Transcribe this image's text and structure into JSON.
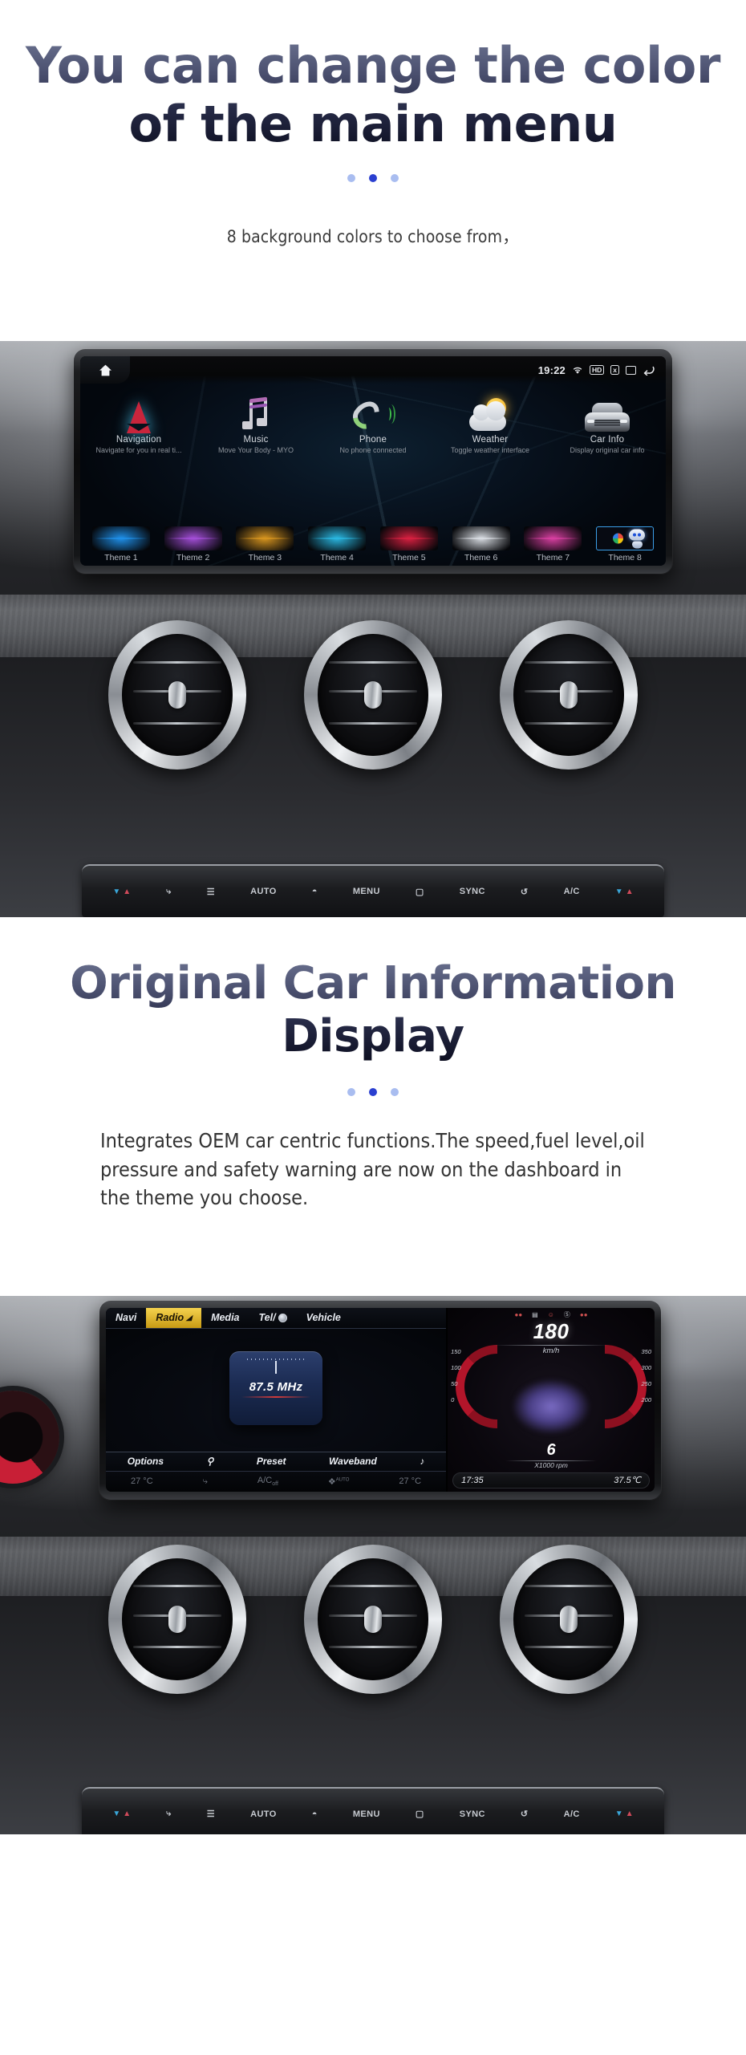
{
  "section1": {
    "title_line1": "You can change the color",
    "title_line2": "of the main menu",
    "subtitle": "8 background colors  to choose from，"
  },
  "section2": {
    "title_line1": "Original Car Information",
    "title_line2": "Display",
    "body": "Integrates OEM car centric functions.The speed,fuel level,oil pressure and safety warning are now on the dashboard in the theme you choose."
  },
  "headunit1": {
    "statusbar": {
      "home_icon": "home-icon",
      "time": "19:22",
      "wifi_icon": "wifi-icon",
      "hd_label": "HD",
      "sd_label": "x",
      "recent_icon": "recent-apps-icon",
      "back_icon": "back-arrow-icon"
    },
    "apps": [
      {
        "name": "Navigation",
        "desc": "Navigate for you in real ti...",
        "icon": "navigation-arrow-icon"
      },
      {
        "name": "Music",
        "desc": "Move Your Body - MYO",
        "icon": "music-note-icon"
      },
      {
        "name": "Phone",
        "desc": "No phone connected",
        "icon": "phone-handset-icon"
      },
      {
        "name": "Weather",
        "desc": "Toggle weather interface",
        "icon": "sun-cloud-icon"
      },
      {
        "name": "Car Info",
        "desc": "Display original car info",
        "icon": "car-front-icon"
      }
    ],
    "themes": [
      {
        "label": "Theme 1",
        "color": "#1f8fe8",
        "selected": false
      },
      {
        "label": "Theme 2",
        "color": "#a24ed6",
        "selected": false
      },
      {
        "label": "Theme 3",
        "color": "#d6941f",
        "selected": false
      },
      {
        "label": "Theme 4",
        "color": "#2ab6e0",
        "selected": false
      },
      {
        "label": "Theme 5",
        "color": "#d62040",
        "selected": false
      },
      {
        "label": "Theme 6",
        "color": "#d8dce2",
        "selected": false
      },
      {
        "label": "Theme 7",
        "color": "#d63fa0",
        "selected": false
      },
      {
        "label": "Theme 8",
        "color": "#1b2a44",
        "selected": true
      }
    ]
  },
  "climate_console": {
    "buttons": [
      "temp-down-up-left",
      "airflow-icon",
      "fan-off-icon",
      "AUTO",
      "defrost-max-icon",
      "MENU",
      "rear-defrost-max-icon",
      "SYNC",
      "recirculate-icon",
      "A/C",
      "temp-down-up-right"
    ],
    "labels": {
      "auto": "AUTO",
      "menu": "MENU",
      "sync": "SYNC",
      "ac": "A/C"
    }
  },
  "headunit2": {
    "comand": {
      "tabs": [
        {
          "label": "Navi",
          "active": false
        },
        {
          "label": "Radio",
          "active": true
        },
        {
          "label": "Media",
          "active": false
        },
        {
          "label": "Tel/",
          "active": false,
          "icon": "globe-icon"
        },
        {
          "label": "Vehicle",
          "active": false
        }
      ],
      "frequency": "87.5 MHz",
      "bottom_buttons": [
        {
          "label": "Options",
          "icon": ""
        },
        {
          "label": "",
          "icon": "search-icon"
        },
        {
          "label": "Preset",
          "icon": ""
        },
        {
          "label": "Waveband",
          "icon": ""
        },
        {
          "label": "",
          "icon": "audio-note-icon"
        }
      ],
      "climate": {
        "temp_left": "27 °C",
        "airflow_icon": "airflow-icon",
        "ac_label": "A/C",
        "ac_state": "off",
        "fan_icon": "fan-auto-icon",
        "fan_label": "AUTO",
        "temp_right": "27 °C"
      }
    },
    "cluster": {
      "speed_value": "180",
      "speed_unit": "km/h",
      "speed_ticks_left": [
        "150",
        "100",
        "50",
        "0"
      ],
      "speed_ticks_right": [
        "350",
        "300",
        "250",
        "200"
      ],
      "rpm_value": "6",
      "rpm_unit": "X1000 rpm",
      "time": "17:35",
      "temperature": "37.5℃",
      "telltales": [
        "warn-left",
        "abs-icon",
        "seatbelt-icon",
        "brake-icon",
        "warn-right"
      ]
    }
  },
  "colors": {
    "title_gradient_top": "#6b7290",
    "title_gradient_bottom": "#0c0e20",
    "dot_active": "#2a3fd0",
    "dot_inactive": "#a9bdf0",
    "accent_gold": "#f5d24e",
    "accent_red": "#b3152a",
    "selected_border": "#3b9ee8"
  }
}
